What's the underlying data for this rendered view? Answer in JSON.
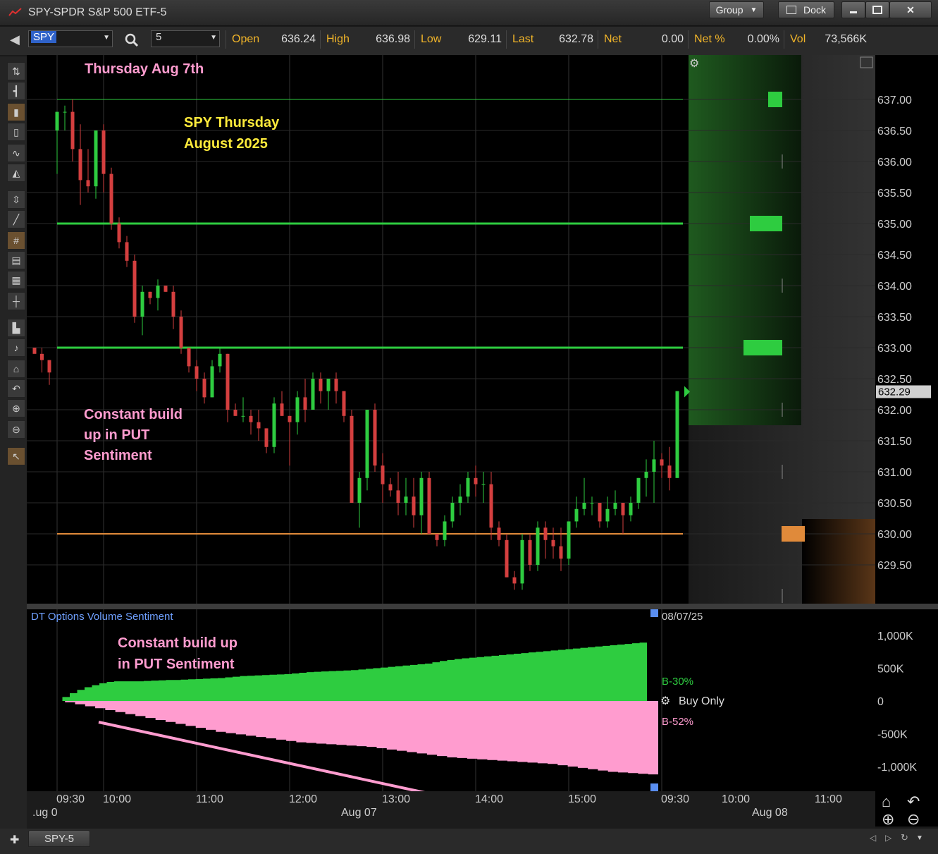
{
  "window": {
    "title": "SPY-SPDR S&P 500 ETF-5",
    "group_label": "Group",
    "dock_label": "Dock",
    "minimize_icon": "minimize-icon",
    "maximize_icon": "maximize-icon",
    "close_icon": "close-icon"
  },
  "toolbar": {
    "symbol": "SPY",
    "interval": "5",
    "quotes": [
      {
        "label": "Open",
        "value": "636.24"
      },
      {
        "label": "High",
        "value": "636.98"
      },
      {
        "label": "Low",
        "value": "629.11"
      },
      {
        "label": "Last",
        "value": "632.78"
      },
      {
        "label": "Net",
        "value": "0.00"
      },
      {
        "label": "Net %",
        "value": "0.00%"
      },
      {
        "label": "Vol",
        "value": "73,566K"
      }
    ]
  },
  "annotations": {
    "top_left": "Thursday Aug 7th",
    "title_line1": "SPY Thursday",
    "title_line2": "August 2025",
    "mid_line1": "Constant build",
    "mid_line2": "up in PUT",
    "mid_line3": "Sentiment",
    "lower_line1": "Constant build up",
    "lower_line2": "in PUT Sentiment"
  },
  "indicator": {
    "name": "DT Options Volume Sentiment",
    "date": "08/07/25",
    "buy_label": "B-30%",
    "sell_label": "B-52%",
    "mode": "Buy Only",
    "mode_icon": "gear-icon"
  },
  "price_tag": "632.29",
  "tab": {
    "label": "SPY-5"
  },
  "colors": {
    "up": "#2ecc40",
    "down": "#d43f3f",
    "put": "#ff9ccf",
    "level": "#2ecc40",
    "support": "#e08a3a",
    "annotation_pink": "#ff9ccf",
    "annotation_yellow": "#ffeb3b"
  },
  "chart_data": [
    {
      "type": "candlestick",
      "title": "",
      "yaxis_ticks": [
        "637.00",
        "636.50",
        "636.00",
        "635.50",
        "635.00",
        "634.50",
        "634.00",
        "633.50",
        "633.00",
        "632.50",
        "632.00",
        "631.50",
        "631.00",
        "630.50",
        "630.00",
        "629.50"
      ],
      "ylim": [
        629.0,
        637.5
      ],
      "xaxis_ticks": [
        "09:30",
        "10:00",
        "11:00",
        "12:00",
        "13:00",
        "14:00",
        "15:00",
        "09:30",
        "10:00",
        "11:00"
      ],
      "date_labels": [
        ".ug 0",
        "Aug 07",
        "Aug 08"
      ],
      "horizontal_levels": [
        637.0,
        635.0,
        633.0,
        630.0
      ],
      "last_price": 632.29,
      "volume_profile_levels": [
        637.0,
        635.0,
        633.0,
        630.0
      ],
      "candles": [
        [
          633.0,
          633.0,
          633.0,
          632.9
        ],
        [
          632.9,
          633.0,
          632.6,
          632.8
        ],
        [
          632.8,
          632.8,
          632.4,
          632.6
        ],
        [
          636.5,
          636.8,
          635.8,
          636.8
        ],
        [
          636.8,
          636.9,
          636.5,
          636.8
        ],
        [
          636.8,
          637.0,
          636.0,
          636.2
        ],
        [
          636.2,
          636.6,
          635.3,
          635.7
        ],
        [
          635.7,
          636.2,
          635.5,
          635.6
        ],
        [
          635.6,
          636.4,
          635.4,
          636.5
        ],
        [
          636.5,
          636.6,
          635.5,
          635.8
        ],
        [
          635.8,
          635.9,
          634.9,
          635.0
        ],
        [
          635.0,
          635.1,
          634.6,
          634.7
        ],
        [
          634.7,
          634.8,
          634.3,
          634.4
        ],
        [
          634.4,
          634.5,
          633.4,
          633.5
        ],
        [
          633.5,
          634.0,
          633.2,
          633.9
        ],
        [
          633.9,
          633.9,
          633.7,
          633.8
        ],
        [
          633.8,
          634.1,
          633.6,
          634.0
        ],
        [
          634.0,
          634.0,
          633.9,
          633.9
        ],
        [
          633.9,
          634.0,
          633.3,
          633.5
        ],
        [
          633.5,
          633.6,
          632.9,
          633.0
        ],
        [
          633.0,
          633.0,
          632.6,
          632.7
        ],
        [
          632.7,
          632.8,
          632.3,
          632.5
        ],
        [
          632.5,
          632.6,
          632.1,
          632.2
        ],
        [
          632.2,
          632.8,
          632.2,
          632.7
        ],
        [
          632.7,
          633.0,
          632.6,
          632.9
        ],
        [
          632.9,
          632.9,
          631.8,
          632.0
        ],
        [
          632.0,
          632.1,
          631.9,
          631.9
        ],
        [
          631.9,
          632.2,
          631.8,
          631.9
        ],
        [
          631.9,
          632.0,
          631.6,
          631.8
        ],
        [
          631.8,
          632.0,
          631.5,
          631.7
        ],
        [
          631.7,
          631.7,
          631.3,
          631.4
        ],
        [
          631.4,
          632.2,
          631.3,
          632.1
        ],
        [
          632.1,
          632.3,
          631.9,
          631.9
        ],
        [
          631.9,
          631.9,
          631.1,
          631.8
        ],
        [
          631.8,
          632.3,
          631.6,
          632.2
        ],
        [
          632.2,
          632.5,
          631.8,
          632.0
        ],
        [
          632.0,
          632.6,
          632.0,
          632.5
        ],
        [
          632.5,
          632.6,
          632.1,
          632.3
        ],
        [
          632.3,
          632.5,
          632.0,
          632.5
        ],
        [
          632.5,
          632.6,
          632.1,
          632.3
        ],
        [
          632.3,
          632.3,
          631.8,
          631.9
        ],
        [
          631.9,
          632.0,
          630.5,
          630.5
        ],
        [
          630.5,
          631.0,
          630.1,
          630.9
        ],
        [
          630.9,
          632.0,
          630.7,
          632.0
        ],
        [
          632.0,
          632.1,
          631.0,
          631.1
        ],
        [
          631.1,
          631.3,
          630.5,
          630.8
        ],
        [
          630.8,
          630.9,
          630.6,
          630.7
        ],
        [
          630.7,
          631.0,
          630.3,
          630.5
        ],
        [
          630.5,
          630.9,
          630.3,
          630.6
        ],
        [
          630.6,
          630.9,
          630.1,
          630.3
        ],
        [
          630.3,
          631.0,
          630.0,
          630.9
        ],
        [
          630.9,
          631.0,
          630.0,
          630.0
        ],
        [
          630.0,
          630.0,
          629.8,
          629.9
        ],
        [
          629.9,
          630.3,
          629.8,
          630.2
        ],
        [
          630.2,
          630.6,
          630.1,
          630.5
        ],
        [
          630.5,
          630.8,
          630.3,
          630.6
        ],
        [
          630.6,
          631.0,
          630.5,
          630.9
        ],
        [
          630.9,
          631.1,
          630.6,
          630.8
        ],
        [
          630.8,
          631.0,
          630.5,
          630.8
        ],
        [
          630.8,
          631.0,
          629.9,
          630.1
        ],
        [
          630.1,
          630.2,
          629.8,
          629.9
        ],
        [
          629.9,
          630.0,
          629.3,
          629.3
        ],
        [
          629.3,
          629.4,
          629.1,
          629.2
        ],
        [
          629.2,
          630.0,
          629.1,
          629.9
        ],
        [
          629.9,
          630.0,
          629.4,
          629.5
        ],
        [
          629.5,
          630.2,
          629.4,
          630.1
        ],
        [
          630.1,
          630.2,
          629.6,
          629.9
        ],
        [
          629.9,
          630.1,
          629.6,
          629.8
        ],
        [
          629.8,
          630.1,
          629.4,
          629.6
        ],
        [
          629.6,
          630.1,
          629.5,
          630.2
        ],
        [
          630.2,
          630.6,
          630.1,
          630.4
        ],
        [
          630.4,
          630.9,
          630.3,
          630.5
        ],
        [
          630.5,
          630.6,
          630.3,
          630.5
        ],
        [
          630.5,
          630.5,
          630.1,
          630.2
        ],
        [
          630.2,
          630.6,
          630.1,
          630.4
        ],
        [
          630.4,
          630.7,
          630.3,
          630.5
        ],
        [
          630.5,
          630.5,
          630.0,
          630.3
        ],
        [
          630.3,
          630.6,
          630.2,
          630.5
        ],
        [
          630.5,
          630.9,
          630.4,
          630.9
        ],
        [
          630.9,
          631.2,
          630.6,
          631.0
        ],
        [
          631.0,
          631.5,
          630.5,
          631.2
        ],
        [
          631.2,
          631.3,
          630.9,
          631.1
        ],
        [
          631.1,
          631.4,
          630.7,
          630.9
        ],
        [
          630.9,
          632.3,
          630.9,
          632.3
        ]
      ]
    },
    {
      "type": "area",
      "title": "DT Options Volume Sentiment",
      "yaxis_ticks": [
        "1,000K",
        "500K",
        "0",
        "-500K",
        "-1,000K"
      ],
      "ylim": [
        -1150,
        1200
      ],
      "series": [
        {
          "name": "B-30%",
          "values": [
            0,
            60,
            120,
            170,
            210,
            240,
            270,
            290,
            300,
            300,
            300,
            300,
            305,
            310,
            315,
            320,
            320,
            325,
            330,
            335,
            340,
            345,
            350,
            360,
            370,
            380,
            385,
            390,
            395,
            400,
            405,
            410,
            420,
            430,
            440,
            445,
            450,
            455,
            460,
            465,
            470,
            480,
            490,
            500,
            510,
            520,
            530,
            540,
            550,
            560,
            570,
            590,
            610,
            625,
            640,
            650,
            660,
            670,
            680,
            690,
            700,
            710,
            720,
            730,
            740,
            750,
            760,
            770,
            780,
            790,
            800,
            810,
            820,
            830,
            840,
            850,
            860,
            870,
            880,
            890
          ]
        },
        {
          "name": "B-52%",
          "values": [
            0,
            -20,
            -50,
            -80,
            -110,
            -140,
            -170,
            -200,
            -230,
            -260,
            -290,
            -320,
            -350,
            -380,
            -410,
            -440,
            -470,
            -490,
            -510,
            -530,
            -550,
            -570,
            -590,
            -610,
            -630,
            -640,
            -650,
            -660,
            -670,
            -680,
            -690,
            -700,
            -720,
            -740,
            -760,
            -780,
            -800,
            -820,
            -840,
            -860,
            -870,
            -880,
            -890,
            -900,
            -910,
            -920,
            -930,
            -940,
            -950,
            -960,
            -980,
            -1000,
            -1020,
            -1040,
            -1060,
            -1080,
            -1090,
            -1100,
            -1110,
            -1120
          ]
        }
      ]
    }
  ]
}
